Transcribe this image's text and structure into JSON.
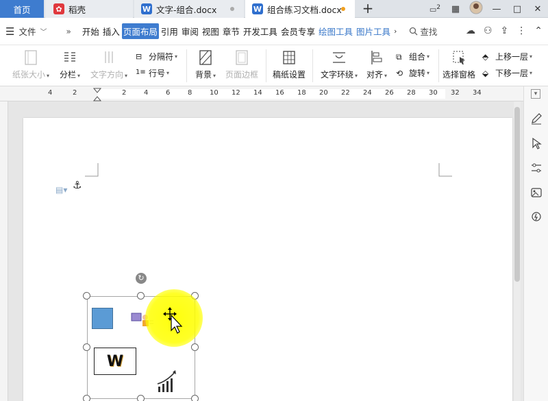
{
  "tabs": {
    "home": "首页",
    "daoke": "稻壳",
    "doc1": "文字-组合.docx",
    "doc2": "组合练习文档.docx",
    "new_tab": "+"
  },
  "window": {
    "page_badge": "2",
    "minimize": "—",
    "maximize": "□",
    "close": "✕"
  },
  "menu": {
    "file": "文件",
    "items": [
      {
        "label": "开始",
        "active": false
      },
      {
        "label": "插入",
        "active": false
      },
      {
        "label": "页面布局",
        "active": true
      },
      {
        "label": "引用",
        "active": false
      },
      {
        "label": "审阅",
        "active": false
      },
      {
        "label": "视图",
        "active": false
      },
      {
        "label": "章节",
        "active": false
      },
      {
        "label": "开发工具",
        "active": false
      },
      {
        "label": "会员专享",
        "active": false
      },
      {
        "label": "绘图工具",
        "active": false,
        "blue": true
      },
      {
        "label": "图片工具",
        "active": false,
        "blue": true
      }
    ],
    "search": "查找"
  },
  "ribbon": {
    "paper_size": "纸张大小",
    "columns": "分栏",
    "text_direction": "文字方向",
    "separator": "分隔符",
    "line_number": "行号",
    "background": "背景",
    "page_border": "页面边框",
    "manuscript": "稿纸设置",
    "text_wrap": "文字环绕",
    "align": "对齐",
    "group": "组合",
    "rotate": "旋转",
    "selection_pane": "选择窗格",
    "bring_forward": "上移一层",
    "send_backward": "下移一层"
  },
  "ruler": {
    "ticks": [
      "4",
      "2",
      "2",
      "4",
      "6",
      "8",
      "10",
      "12",
      "14",
      "16",
      "18",
      "20",
      "22",
      "24",
      "26",
      "28",
      "30",
      "32",
      "34"
    ]
  },
  "shapes": {
    "w_text": "W"
  },
  "colors": {
    "accent": "#3e7ccf",
    "shape_blue": "#5b9bd5",
    "highlight": "#ffff00"
  }
}
